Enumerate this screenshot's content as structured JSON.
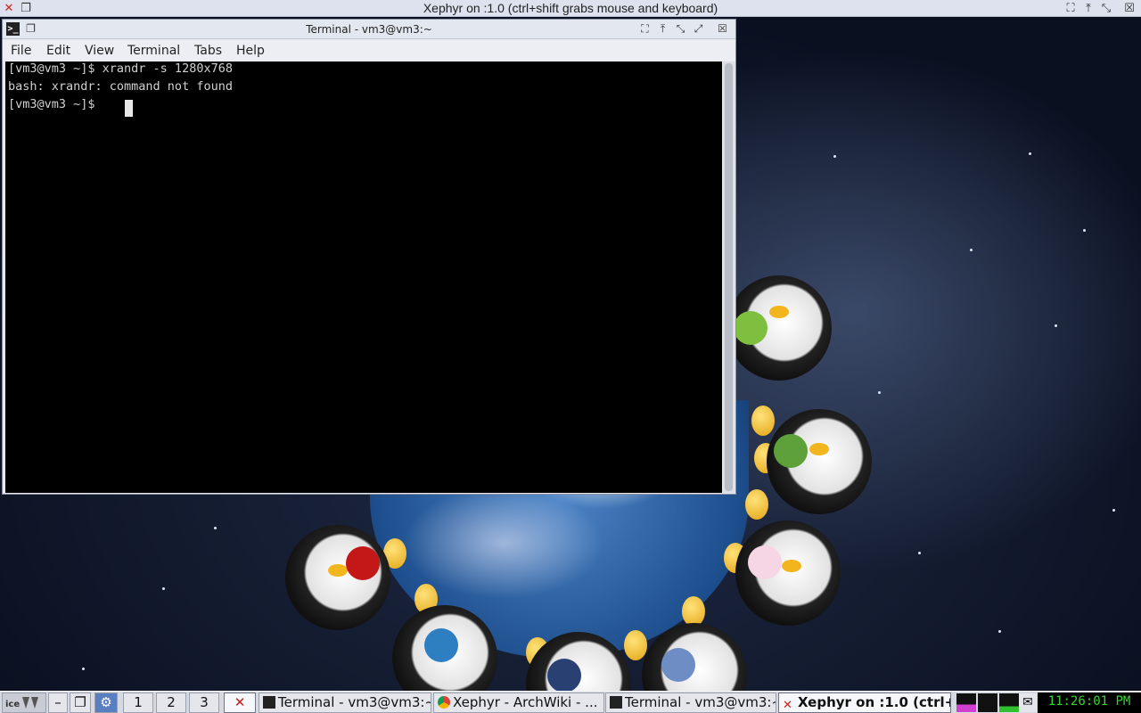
{
  "xephyr": {
    "title": "Xephyr on :1.0 (ctrl+shift grabs mouse and keyboard)"
  },
  "terminal": {
    "title": "Terminal - vm3@vm3:~",
    "menu": [
      "File",
      "Edit",
      "View",
      "Terminal",
      "Tabs",
      "Help"
    ],
    "lines": [
      "[vm3@vm3 ~]$ xrandr -s 1280x768",
      "bash: xrandr: command not found",
      "[vm3@vm3 ~]$ "
    ]
  },
  "taskbar": {
    "desktops": [
      "1",
      "2",
      "3"
    ],
    "tasks": [
      {
        "label": "Terminal - vm3@vm3:~"
      },
      {
        "label": "Xephyr - ArchWiki - ..."
      },
      {
        "label": "Terminal - vm3@vm3:~"
      },
      {
        "label": "Xephyr on :1.0 (ctrl+..."
      }
    ],
    "clock": "11:26:01 PM"
  },
  "colors": {
    "terminal_bg": "#000000",
    "terminal_fg": "#d0d0d0",
    "clock_fg": "#35d435"
  }
}
